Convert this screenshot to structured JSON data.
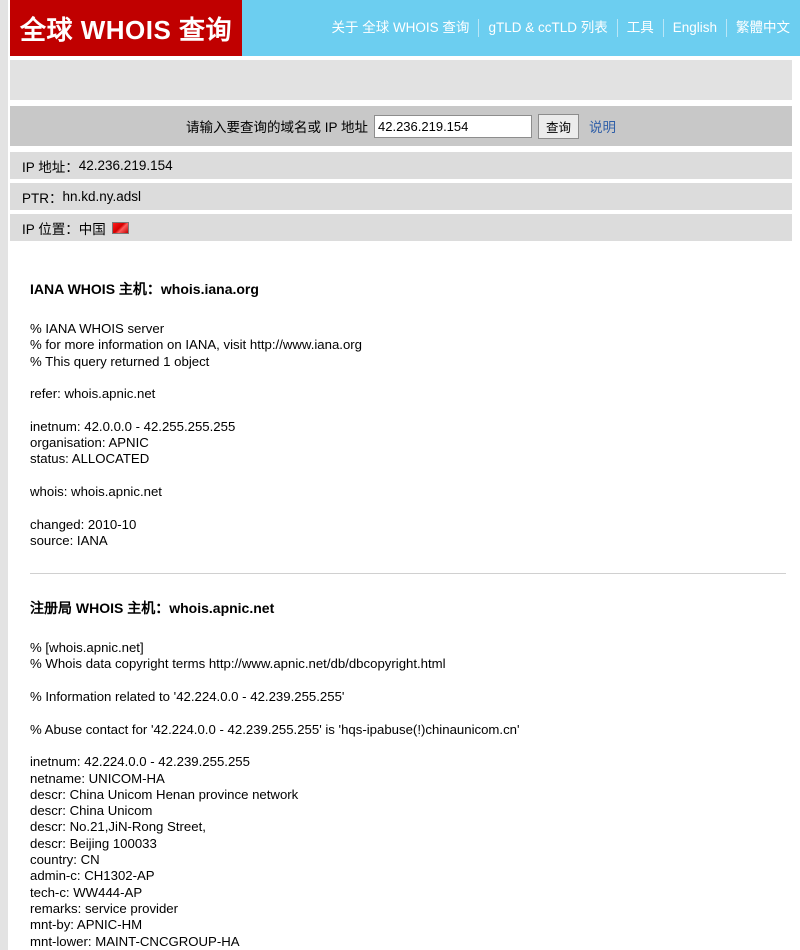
{
  "header": {
    "logo_text": "全球 WHOIS 查询",
    "logo_color": "#c00000",
    "nav_background": "#6ccef0",
    "nav_items": [
      {
        "label": "关于 全球 WHOIS 查询"
      },
      {
        "label": "gTLD & ccTLD 列表"
      },
      {
        "label": "工具"
      },
      {
        "label": "English"
      },
      {
        "label": "繁體中文"
      }
    ]
  },
  "search": {
    "label": "请输入要查询的域名或 IP 地址",
    "value": "42.236.219.154",
    "placeholder": "",
    "button_label": "查询",
    "help_label": "说明",
    "help_color": "#2f5fa8"
  },
  "info_rows": [
    {
      "label": "IP 地址：",
      "value": "42.236.219.154",
      "flag": false
    },
    {
      "label": "PTR：",
      "value": "hn.kd.ny.adsl",
      "flag": false
    },
    {
      "label": "IP 位置：",
      "value": "中国",
      "flag": true,
      "flag_name": "china-flag-icon"
    }
  ],
  "sections": [
    {
      "title": "IANA WHOIS 主机：whois.iana.org",
      "body": "% IANA WHOIS server\n% for more information on IANA, visit http://www.iana.org\n% This query returned 1 object\n\nrefer: whois.apnic.net\n\ninetnum: 42.0.0.0 - 42.255.255.255\norganisation: APNIC\nstatus: ALLOCATED\n\nwhois: whois.apnic.net\n\nchanged: 2010-10\nsource: IANA"
    },
    {
      "title": "注册局 WHOIS 主机：whois.apnic.net",
      "body": "% [whois.apnic.net]\n% Whois data copyright terms http://www.apnic.net/db/dbcopyright.html\n\n% Information related to '42.224.0.0 - 42.239.255.255'\n\n% Abuse contact for '42.224.0.0 - 42.239.255.255' is 'hqs-ipabuse(!)chinaunicom.cn'\n\ninetnum: 42.224.0.0 - 42.239.255.255\nnetname: UNICOM-HA\ndescr: China Unicom Henan province network\ndescr: China Unicom\ndescr: No.21,JiN-Rong Street,\ndescr: Beijing 100033\ncountry: CN\nadmin-c: CH1302-AP\ntech-c: WW444-AP\nremarks: service provider\nmnt-by: APNIC-HM\nmnt-lower: MAINT-CNCGROUP-HA"
    }
  ]
}
